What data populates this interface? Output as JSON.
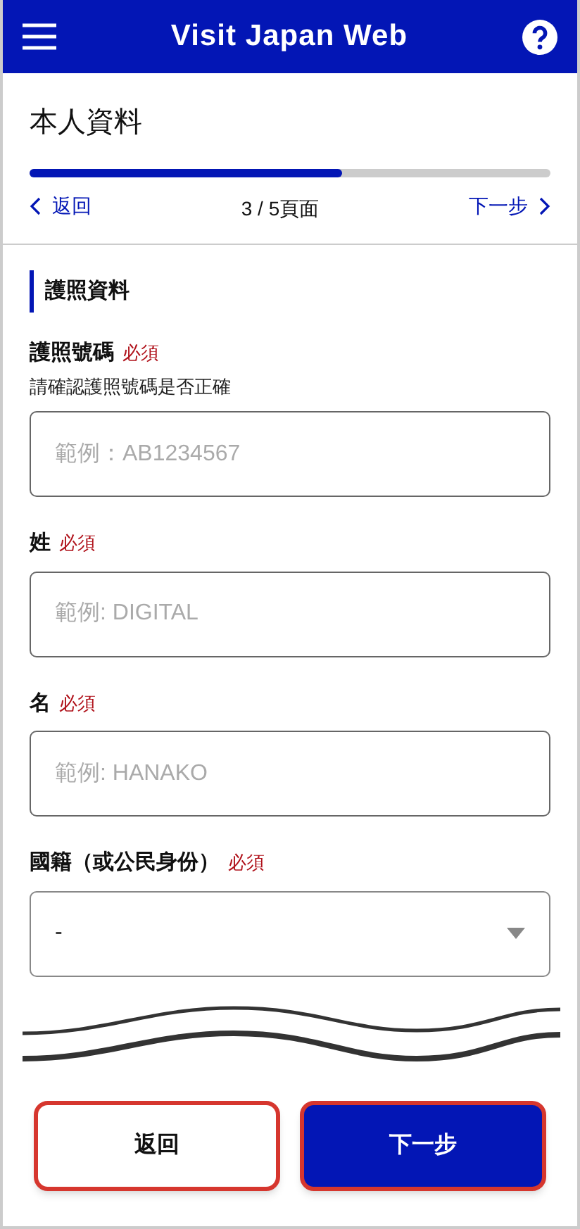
{
  "header": {
    "title": "Visit Japan Web"
  },
  "page": {
    "title": "本人資料",
    "progress": {
      "level": 0.6
    },
    "nav": {
      "back": "返回",
      "indicator": "3 / 5頁面",
      "next": "下一步"
    }
  },
  "section": {
    "title": "護照資料"
  },
  "fields": [
    {
      "kind": "text",
      "label": "護照號碼",
      "required": "必須",
      "hint": "請確認護照號碼是否正確",
      "placeholder": "範例：AB1234567"
    },
    {
      "kind": "text",
      "label": "姓",
      "required": "必須",
      "placeholder": "範例: DIGITAL"
    },
    {
      "kind": "text",
      "label": "名",
      "required": "必須",
      "placeholder": "範例: HANAKO"
    },
    {
      "kind": "select",
      "label": "國籍（或公民身份）",
      "required": "必須",
      "value": "-"
    }
  ],
  "buttons": [
    {
      "label": "返回",
      "kind": "secondary",
      "highlighted": true
    },
    {
      "label": "下一步",
      "kind": "primary",
      "highlighted": true
    }
  ]
}
